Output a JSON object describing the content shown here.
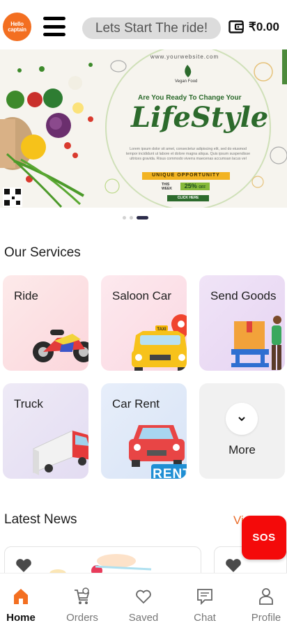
{
  "header": {
    "logo_text": "Hello captain",
    "ride_prompt": "Lets Start The ride!",
    "wallet_amount": "₹0.00"
  },
  "banner": {
    "website": "www.yourwebsite.com",
    "brand": "Vegan Food",
    "headline": "Are You Ready To Change Your",
    "script_title": "LifeStyle",
    "body": "Lorem ipsum dolor sit amet, consectetur adipiscing elit, sed do eiusmod tempor incididunt ut labore et dolore magna aliqua. Quis ipsum suspendisse ultrices gravida. Risus commodo viverra maecenas accumsan lacus vel facilisis.",
    "ribbon": "UNIQUE OPPORTUNITY",
    "this_week": "THIS WEEK",
    "discount": "25%",
    "discount_suffix": "OFF",
    "cta": "CLICK HERE",
    "slide_count": 3,
    "active_slide": 3
  },
  "services": {
    "title": "Our Services",
    "items": [
      {
        "label": "Ride",
        "icon": "motorbike-icon"
      },
      {
        "label": "Saloon Car",
        "icon": "taxi-icon"
      },
      {
        "label": "Send Goods",
        "icon": "delivery-person-icon"
      },
      {
        "label": "Truck",
        "icon": "truck-icon"
      },
      {
        "label": "Car Rent",
        "icon": "rent-car-icon"
      },
      {
        "label": "More",
        "icon": "chevron-down-icon"
      }
    ],
    "rent_badge": "RENT",
    "taxi_sign": "TAXI"
  },
  "news": {
    "title": "Latest News",
    "view_all": "View All"
  },
  "sos": {
    "label": "SOS"
  },
  "bottom_nav": [
    {
      "label": "Home",
      "icon": "home-icon",
      "active": true
    },
    {
      "label": "Orders",
      "icon": "cart-icon",
      "active": false
    },
    {
      "label": "Saved",
      "icon": "heart-icon",
      "active": false
    },
    {
      "label": "Chat",
      "icon": "chat-icon",
      "active": false
    },
    {
      "label": "Profile",
      "icon": "profile-icon",
      "active": false
    }
  ],
  "colors": {
    "brand_orange": "#f36f21",
    "sos_red": "#f40a0a",
    "view_all": "#e96a27"
  }
}
